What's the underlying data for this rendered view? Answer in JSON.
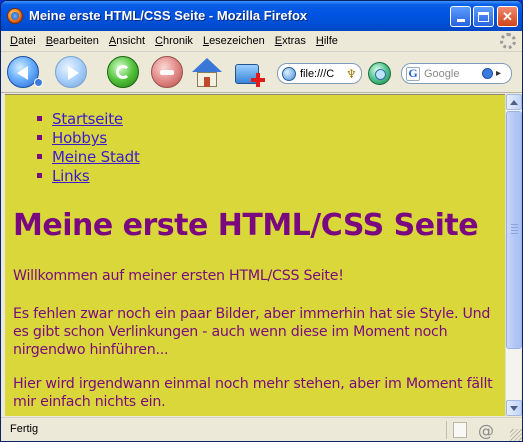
{
  "window": {
    "title": "Meine erste HTML/CSS Seite - Mozilla Firefox"
  },
  "menu": {
    "items": [
      {
        "label": "Datei",
        "access": "D",
        "rest": "atei"
      },
      {
        "label": "Bearbeiten",
        "access": "B",
        "rest": "earbeiten"
      },
      {
        "label": "Ansicht",
        "access": "A",
        "rest": "nsicht"
      },
      {
        "label": "Chronik",
        "access": "C",
        "rest": "hronik"
      },
      {
        "label": "Lesezeichen",
        "access": "L",
        "rest": "esezeichen"
      },
      {
        "label": "Extras",
        "access": "E",
        "rest": "xtras"
      },
      {
        "label": "Hilfe",
        "access": "H",
        "rest": "ilfe"
      }
    ]
  },
  "toolbar": {
    "back_icon": "back-arrow-icon",
    "forward_icon": "forward-arrow-icon",
    "reload_icon": "reload-icon",
    "stop_icon": "stop-icon",
    "home_icon": "home-icon",
    "bookmark_icon": "add-bookmark-icon"
  },
  "address": {
    "value": "file:///C"
  },
  "search": {
    "placeholder": "Google",
    "engine_letter": "G"
  },
  "page": {
    "background": "#d9d73a",
    "text_color": "#7a0a7f",
    "link_color": "#3c1ad0",
    "nav": [
      {
        "label": "Startseite"
      },
      {
        "label": "Hobbys"
      },
      {
        "label": "Meine Stadt"
      },
      {
        "label": "Links"
      }
    ],
    "heading": "Meine erste HTML/CSS Seite",
    "paragraphs": [
      "Willkommen auf meiner ersten HTML/CSS Seite!",
      "Es fehlen zwar noch ein paar Bilder, aber immerhin hat sie Style. Und es gibt schon Verlinkungen - auch wenn diese im Moment noch nirgendwo hinführen...",
      "Hier wird irgendwann einmal noch mehr stehen, aber im Moment fällt mir einfach nichts ein."
    ]
  },
  "status": {
    "text": "Fertig"
  }
}
